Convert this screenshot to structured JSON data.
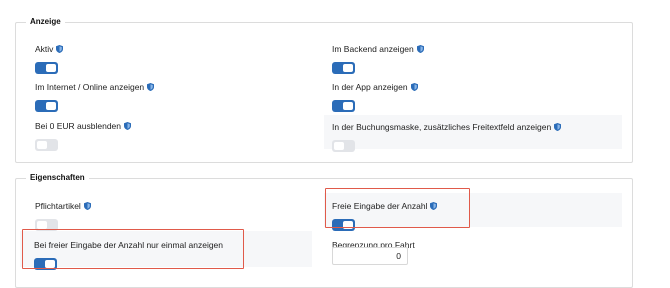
{
  "anzeige": {
    "legend": "Anzeige",
    "fields": [
      {
        "label": "Aktiv",
        "on": true
      },
      {
        "label": "Im Backend anzeigen",
        "on": true
      },
      {
        "label": "Im Internet / Online anzeigen",
        "on": true
      },
      {
        "label": "In der App anzeigen",
        "on": true
      },
      {
        "label": "Bei 0 EUR ausblenden",
        "on": false
      },
      {
        "label": "In der Buchungsmaske, zusätzliches Freitextfeld anzeigen",
        "on": false
      }
    ]
  },
  "eigenschaften": {
    "legend": "Eigenschaften",
    "fields": [
      {
        "label": "Pflichtartikel",
        "on": false
      },
      {
        "label": "Freie Eingabe der Anzahl",
        "on": true
      },
      {
        "label": "Bei freier Eingabe der Anzahl nur einmal anzeigen",
        "on": true
      },
      {
        "label": "Begrenzung pro Fahrt",
        "value": "0"
      }
    ]
  },
  "colors": {
    "toggle_on": "#2b6cb8",
    "toggle_off": "#e2e4e8",
    "highlight": "#e05a4a",
    "shield": "#2b6cb8"
  },
  "icons": {
    "info": "shield-icon"
  }
}
